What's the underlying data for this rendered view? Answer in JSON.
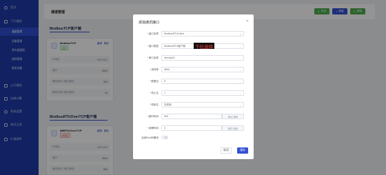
{
  "sidebar": {
    "items": [
      {
        "label": "首页",
        "kind": "top"
      },
      {
        "label": "下行通信",
        "kind": "top"
      },
      {
        "label": "通道管理",
        "kind": "sub",
        "active": true
      },
      {
        "label": "设备管理",
        "kind": "sub"
      },
      {
        "label": "寄存器管理",
        "kind": "sub"
      },
      {
        "label": "规则管理",
        "kind": "sub"
      },
      {
        "label": "服务设备",
        "kind": "sub"
      },
      {
        "label": "上行通信",
        "kind": "top"
      },
      {
        "label": "边缘计算",
        "kind": "top"
      },
      {
        "label": "系统设置",
        "kind": "top"
      },
      {
        "label": "调试工具",
        "kind": "top"
      },
      {
        "label": "扩展插件",
        "kind": "top"
      }
    ]
  },
  "header": {
    "title": "通道管理",
    "buttons": [
      {
        "label": "导出",
        "icon": "export-icon",
        "color": "#4caf50"
      },
      {
        "label": "新增",
        "icon": "plus-icon",
        "color": "#3552d1"
      },
      {
        "label": "刷新",
        "icon": "refresh-icon",
        "color": "#4caf50"
      }
    ]
  },
  "sections": [
    {
      "title": "ModbusTCP客户端",
      "card": {
        "name": "ModbusTCP",
        "status": "连接",
        "actions": [
          "编辑",
          "删除"
        ],
        "rows": [
          {
            "k": "IP地址",
            "v": "127.0.0.1"
          },
          {
            "k": "端口",
            "v": "5002"
          },
          {
            "k": "通讯延时 (单位毫秒)",
            "v": "500"
          },
          {
            "k": "超时时间 (单位毫秒)",
            "v": "15"
          }
        ]
      }
    },
    {
      "title": "ModbusRTUOverTCP客户端",
      "card": {
        "name": "MBRTUOverTCP",
        "status": "未连接",
        "actions": [
          "编辑",
          "删除"
        ],
        "rows": [
          {
            "k": "IP地址",
            "v": "127.0.0.1"
          },
          {
            "k": "端口",
            "v": "5004"
          },
          {
            "k": "通讯延时 (单位毫秒)",
            "v": "500"
          }
        ]
      }
    }
  ],
  "modal": {
    "title": "添加通讯接口",
    "close_icon": "close-icon",
    "fields": [
      {
        "label": "接口名称",
        "value": "ModbusRTUClient",
        "required": true,
        "tail": "≡"
      },
      {
        "label": "接口类型",
        "value": "ModbusRTU客户端",
        "required": true,
        "tail": "⌄"
      },
      {
        "label": "串口名称",
        "value": "/dev/ttyS1",
        "required": true,
        "tail": ""
      },
      {
        "label": "波特率",
        "value": "9600",
        "required": true,
        "tail": "⌄"
      },
      {
        "label": "数据位",
        "value": "8",
        "required": true,
        "tail": "⌄"
      },
      {
        "label": "停止位",
        "value": "1",
        "required": true,
        "tail": "⌄"
      },
      {
        "label": "校验位",
        "value": "无校验",
        "required": true,
        "tail": "⌄"
      },
      {
        "label": "超时时间",
        "value": "500",
        "required": true,
        "unit": "单位:毫秒"
      },
      {
        "label": "间隔时间",
        "value": "0",
        "required": true,
        "unit": "单位:毫秒"
      }
    ],
    "switch_label": "启用Rs485模块",
    "cancel_label": "取消",
    "save_label": "保存",
    "callout_text": "下拉选择"
  }
}
